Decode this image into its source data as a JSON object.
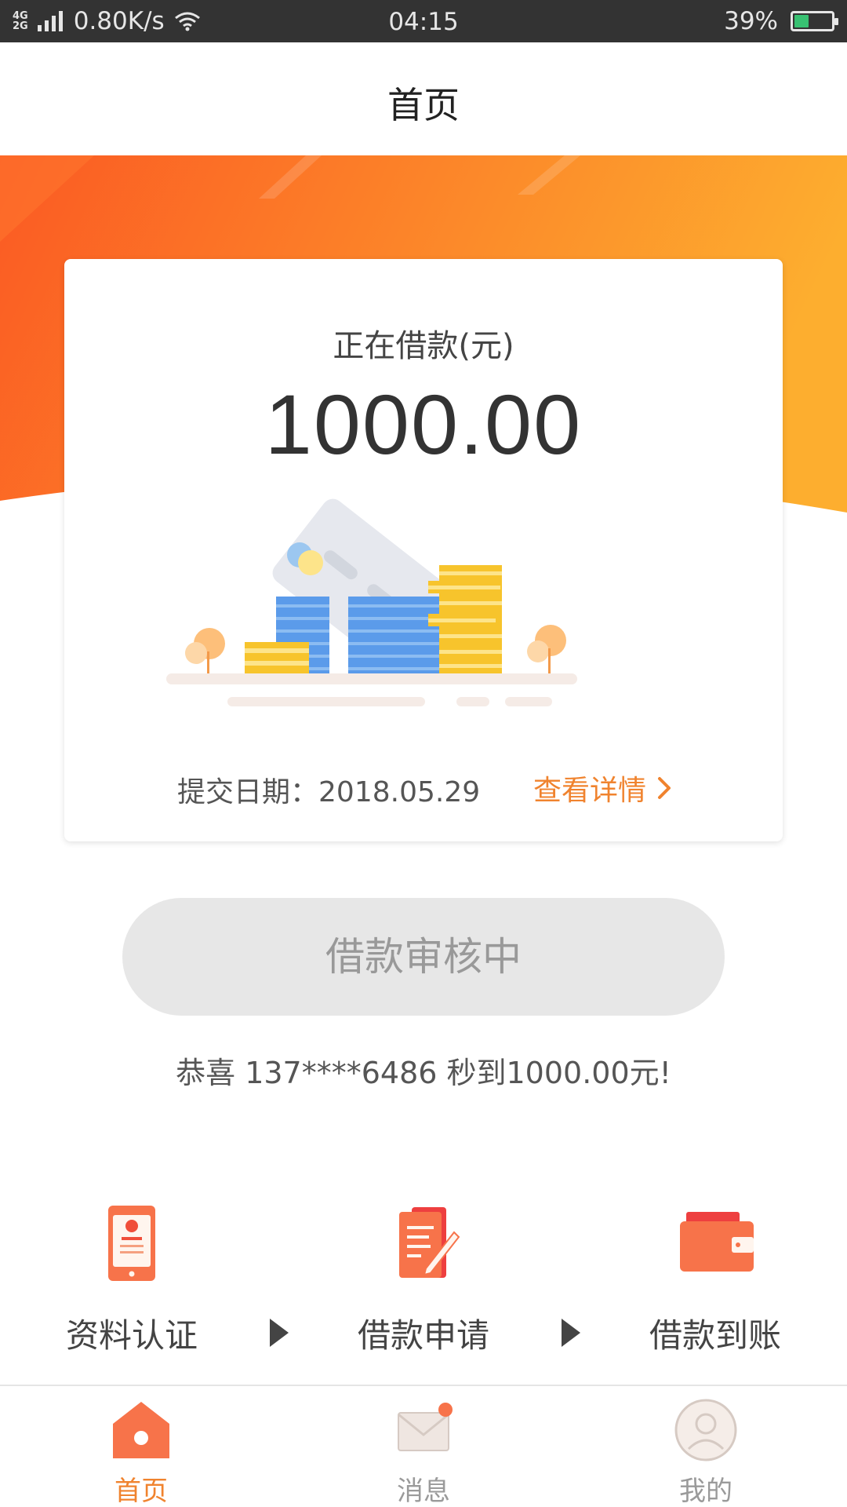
{
  "status_bar": {
    "network_top": "4G",
    "network_bottom": "2G",
    "speed": "0.80K/s",
    "time": "04:15",
    "battery": "39%",
    "battery_level": 0.39
  },
  "header": {
    "title": "首页"
  },
  "loan_card": {
    "label": "正在借款(元)",
    "amount": "1000.00",
    "date_label": "提交日期：",
    "date": "2018.05.29",
    "detail_link": "查看详情"
  },
  "status_button": {
    "label": "借款审核中"
  },
  "congrats": "恭喜 137****6486 秒到1000.00元!",
  "steps": [
    {
      "label": "资料认证",
      "icon": "id-card-icon"
    },
    {
      "label": "借款申请",
      "icon": "document-pen-icon"
    },
    {
      "label": "借款到账",
      "icon": "wallet-icon"
    }
  ],
  "tabs": [
    {
      "label": "首页",
      "icon": "home-icon",
      "active": true
    },
    {
      "label": "消息",
      "icon": "message-icon",
      "active": false
    },
    {
      "label": "我的",
      "icon": "profile-icon",
      "active": false
    }
  ],
  "colors": {
    "accent": "#f0832e",
    "orange_start": "#fb5a23",
    "orange_end": "#fdae2f",
    "status_bar": "#333333",
    "disabled_button": "#e7e7e7",
    "tab_inactive": "#9a9a9a"
  }
}
